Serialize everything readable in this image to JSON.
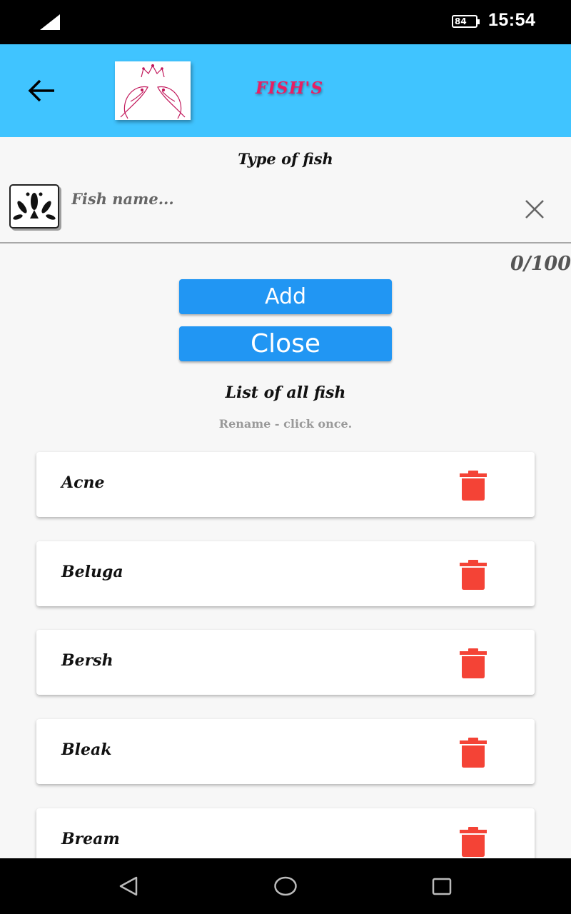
{
  "status_bar": {
    "time": "15:54",
    "battery_level": "84"
  },
  "app_bar": {
    "title": "FISH'S"
  },
  "form": {
    "type_label": "Type of fish",
    "input_placeholder": "Fish name...",
    "input_value": "",
    "counter": "0/100",
    "add_label": "Add",
    "close_label": "Close"
  },
  "list": {
    "title": "List of all fish",
    "hint": "Rename - click once.",
    "items": [
      {
        "name": "Acne"
      },
      {
        "name": "Beluga"
      },
      {
        "name": "Bersh"
      },
      {
        "name": "Bleak"
      },
      {
        "name": "Bream"
      }
    ]
  },
  "colors": {
    "app_bar": "#40c4ff",
    "title_accent": "#e91e63",
    "button": "#2196f3",
    "delete": "#f44336"
  }
}
